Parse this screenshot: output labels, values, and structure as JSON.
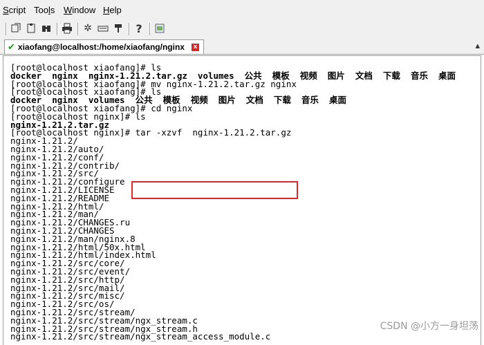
{
  "menu": {
    "script": "Script",
    "tools": "Tools",
    "window": "Window",
    "help": "Help"
  },
  "toolbar": {
    "icons": [
      "reconnect-icon",
      "copy-icon",
      "paste-icon",
      "find-icon",
      "print-icon",
      "settings-icon",
      "keymap-icon",
      "sftp-icon",
      "help-icon",
      "session-log-icon"
    ]
  },
  "tab": {
    "title": "xiaofang@localhost:/home/xiaofang/nginx",
    "status_icon": "connected-check-icon",
    "close_glyph": "x"
  },
  "terminal": {
    "lines": [
      {
        "text": "[root@localhost xiaofang]# ls",
        "bold": false
      },
      {
        "text": "docker  nginx  nginx-1.21.2.tar.gz  volumes  公共  模板  视频  图片  文档  下载  音乐  桌面",
        "bold": true
      },
      {
        "text": "[root@localhost xiaofang]# mv nginx-1.21.2.tar.gz nginx",
        "bold": false
      },
      {
        "text": "[root@localhost xiaofang]# ls",
        "bold": false
      },
      {
        "text": "docker  nginx  volumes  公共  模板  视频  图片  文档  下载  音乐  桌面",
        "bold": true
      },
      {
        "text": "[root@localhost xiaofang]# cd nginx",
        "bold": false
      },
      {
        "text": "[root@localhost nginx]# ls",
        "bold": false
      },
      {
        "text": "nginx-1.21.2.tar.gz",
        "bold": true
      },
      {
        "text": "[root@localhost nginx]# tar -xzvf  nginx-1.21.2.tar.gz",
        "bold": false
      },
      {
        "text": "nginx-1.21.2/",
        "bold": false
      },
      {
        "text": "nginx-1.21.2/auto/",
        "bold": false
      },
      {
        "text": "nginx-1.21.2/conf/",
        "bold": false
      },
      {
        "text": "nginx-1.21.2/contrib/",
        "bold": false
      },
      {
        "text": "nginx-1.21.2/src/",
        "bold": false
      },
      {
        "text": "nginx-1.21.2/configure",
        "bold": false
      },
      {
        "text": "nginx-1.21.2/LICENSE",
        "bold": false
      },
      {
        "text": "nginx-1.21.2/README",
        "bold": false
      },
      {
        "text": "nginx-1.21.2/html/",
        "bold": false
      },
      {
        "text": "nginx-1.21.2/man/",
        "bold": false
      },
      {
        "text": "nginx-1.21.2/CHANGES.ru",
        "bold": false
      },
      {
        "text": "nginx-1.21.2/CHANGES",
        "bold": false
      },
      {
        "text": "nginx-1.21.2/man/nginx.8",
        "bold": false
      },
      {
        "text": "nginx-1.21.2/html/50x.html",
        "bold": false
      },
      {
        "text": "nginx-1.21.2/html/index.html",
        "bold": false
      },
      {
        "text": "nginx-1.21.2/src/core/",
        "bold": false
      },
      {
        "text": "nginx-1.21.2/src/event/",
        "bold": false
      },
      {
        "text": "nginx-1.21.2/src/http/",
        "bold": false
      },
      {
        "text": "nginx-1.21.2/src/mail/",
        "bold": false
      },
      {
        "text": "nginx-1.21.2/src/misc/",
        "bold": false
      },
      {
        "text": "nginx-1.21.2/src/os/",
        "bold": false
      },
      {
        "text": "nginx-1.21.2/src/stream/",
        "bold": false
      },
      {
        "text": "nginx-1.21.2/src/stream/ngx_stream.c",
        "bold": false
      },
      {
        "text": "nginx-1.21.2/src/stream/ngx_stream.h",
        "bold": false
      },
      {
        "text": "nginx-1.21.2/src/stream/ngx_stream_access_module.c",
        "bold": false
      }
    ]
  },
  "watermark": "CSDN @小方一身坦荡",
  "colors": {
    "highlight": "#e0262b",
    "tab_check": "#1a9a1a",
    "tab_close": "#d22a2a"
  }
}
